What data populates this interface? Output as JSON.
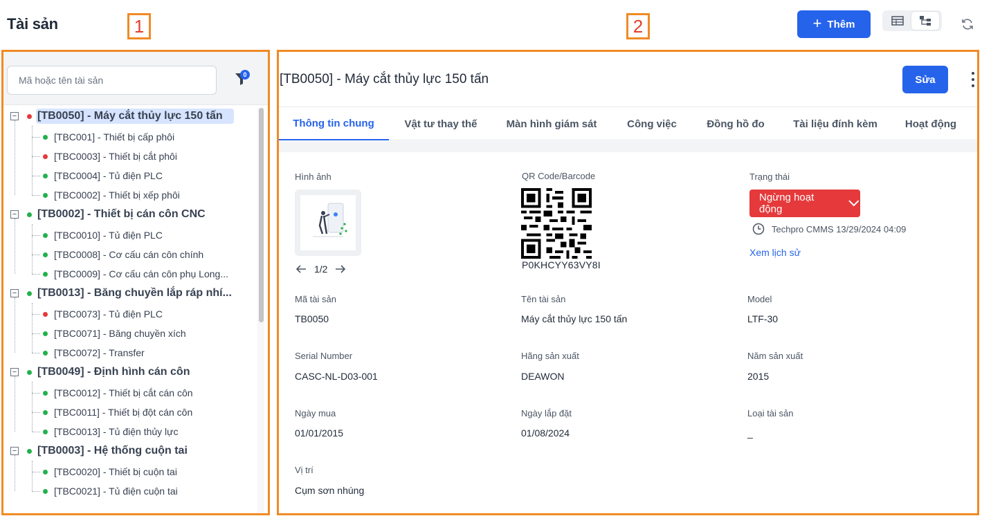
{
  "page": {
    "title": "Tài sản"
  },
  "annotations": [
    "1",
    "2"
  ],
  "header": {
    "add_label": "Thêm",
    "view_icons": [
      "table-icon",
      "tree-icon"
    ],
    "refresh_icon": "refresh-icon"
  },
  "search": {
    "placeholder": "Mã hoặc tên tài sản",
    "filter_count": "0"
  },
  "tree": [
    {
      "code": "[TB0050] - Máy cắt thủy lực 150 tấn",
      "status": "red",
      "selected": true,
      "children": [
        {
          "label": "[TBC001] - Thiết bị cấp phôi",
          "status": "green"
        },
        {
          "label": "[TBC0003] - Thiết bị cắt phôi",
          "status": "red"
        },
        {
          "label": "[TBC0004] - Tủ điện PLC",
          "status": "green"
        },
        {
          "label": "[TBC0002] - Thiết bị xếp phôi",
          "status": "green"
        }
      ]
    },
    {
      "code": "[TB0002] - Thiết bị cán côn CNC",
      "status": "green",
      "children": [
        {
          "label": "[TBC0010] - Tủ điện PLC",
          "status": "green"
        },
        {
          "label": "[TBC0008] - Cơ cấu cán côn chính",
          "status": "green"
        },
        {
          "label": "[TBC0009] - Cơ cấu cán côn phụ Long...",
          "status": "green"
        }
      ]
    },
    {
      "code": "[TB0013] - Băng chuyền lắp ráp nhí...",
      "status": "green",
      "children": [
        {
          "label": "[TBC0073] - Tủ điện PLC",
          "status": "red"
        },
        {
          "label": "[TBC0071] - Băng chuyền xích",
          "status": "green"
        },
        {
          "label": "[TBC0072] - Transfer",
          "status": "green"
        }
      ]
    },
    {
      "code": "[TB0049] - Định hình cán côn",
      "status": "green",
      "children": [
        {
          "label": "[TBC0012] - Thiết bị cắt cán côn",
          "status": "green"
        },
        {
          "label": "[TBC0011] - Thiết bị đột cán côn",
          "status": "green"
        },
        {
          "label": "[TBC0013] - Tủ điện thủy lực",
          "status": "green"
        }
      ]
    },
    {
      "code": "[TB0003] - Hệ thống cuộn tai",
      "status": "green",
      "children": [
        {
          "label": "[TBC0020] - Thiết bị cuộn tai",
          "status": "green"
        },
        {
          "label": "[TBC0021] - Tủ điện cuộn tai",
          "status": "green"
        }
      ]
    }
  ],
  "detail": {
    "title": "[TB0050] - Máy cắt thủy lực 150 tấn",
    "edit_label": "Sửa",
    "tabs": [
      "Thông tin chung",
      "Vật tư thay thế",
      "Màn hình giám sát",
      "Công việc",
      "Đồng hồ đo",
      "Tài liệu đính kèm",
      "Hoạt động"
    ],
    "active_tab": "Thông tin chung",
    "image_label": "Hình ảnh",
    "image_pager": "1/2",
    "qr_label": "QR Code/Barcode",
    "qr_value": "P0KHCYY63VY8I",
    "status_label": "Trạng thái",
    "status_value": "Ngừng hoạt động",
    "status_meta": "Techpro CMMS 13/29/2024 04:09",
    "history_link": "Xem lịch sử",
    "fields": {
      "asset_code": {
        "label": "Mã tài sản",
        "value": "TB0050"
      },
      "asset_name": {
        "label": "Tên tài sản",
        "value": "Máy cắt thủy lực 150 tấn"
      },
      "model": {
        "label": "Model",
        "value": "LTF-30"
      },
      "serial": {
        "label": "Serial Number",
        "value": "CASC-NL-D03-001"
      },
      "manufacturer": {
        "label": "Hãng sản xuất",
        "value": "DEAWON"
      },
      "year": {
        "label": "Năm sản xuất",
        "value": "2015"
      },
      "purchase_date": {
        "label": "Ngày mua",
        "value": "01/01/2015"
      },
      "install_date": {
        "label": "Ngày lắp đặt",
        "value": "01/08/2024"
      },
      "asset_type": {
        "label": "Loại tài sản",
        "value": "_"
      },
      "location": {
        "label": "Vị trí",
        "value": "Cụm sơn nhúng"
      }
    }
  },
  "colors": {
    "primary": "#2563eb",
    "danger": "#e5393b",
    "ok": "#22b14c",
    "annotation": "#f08a24"
  }
}
